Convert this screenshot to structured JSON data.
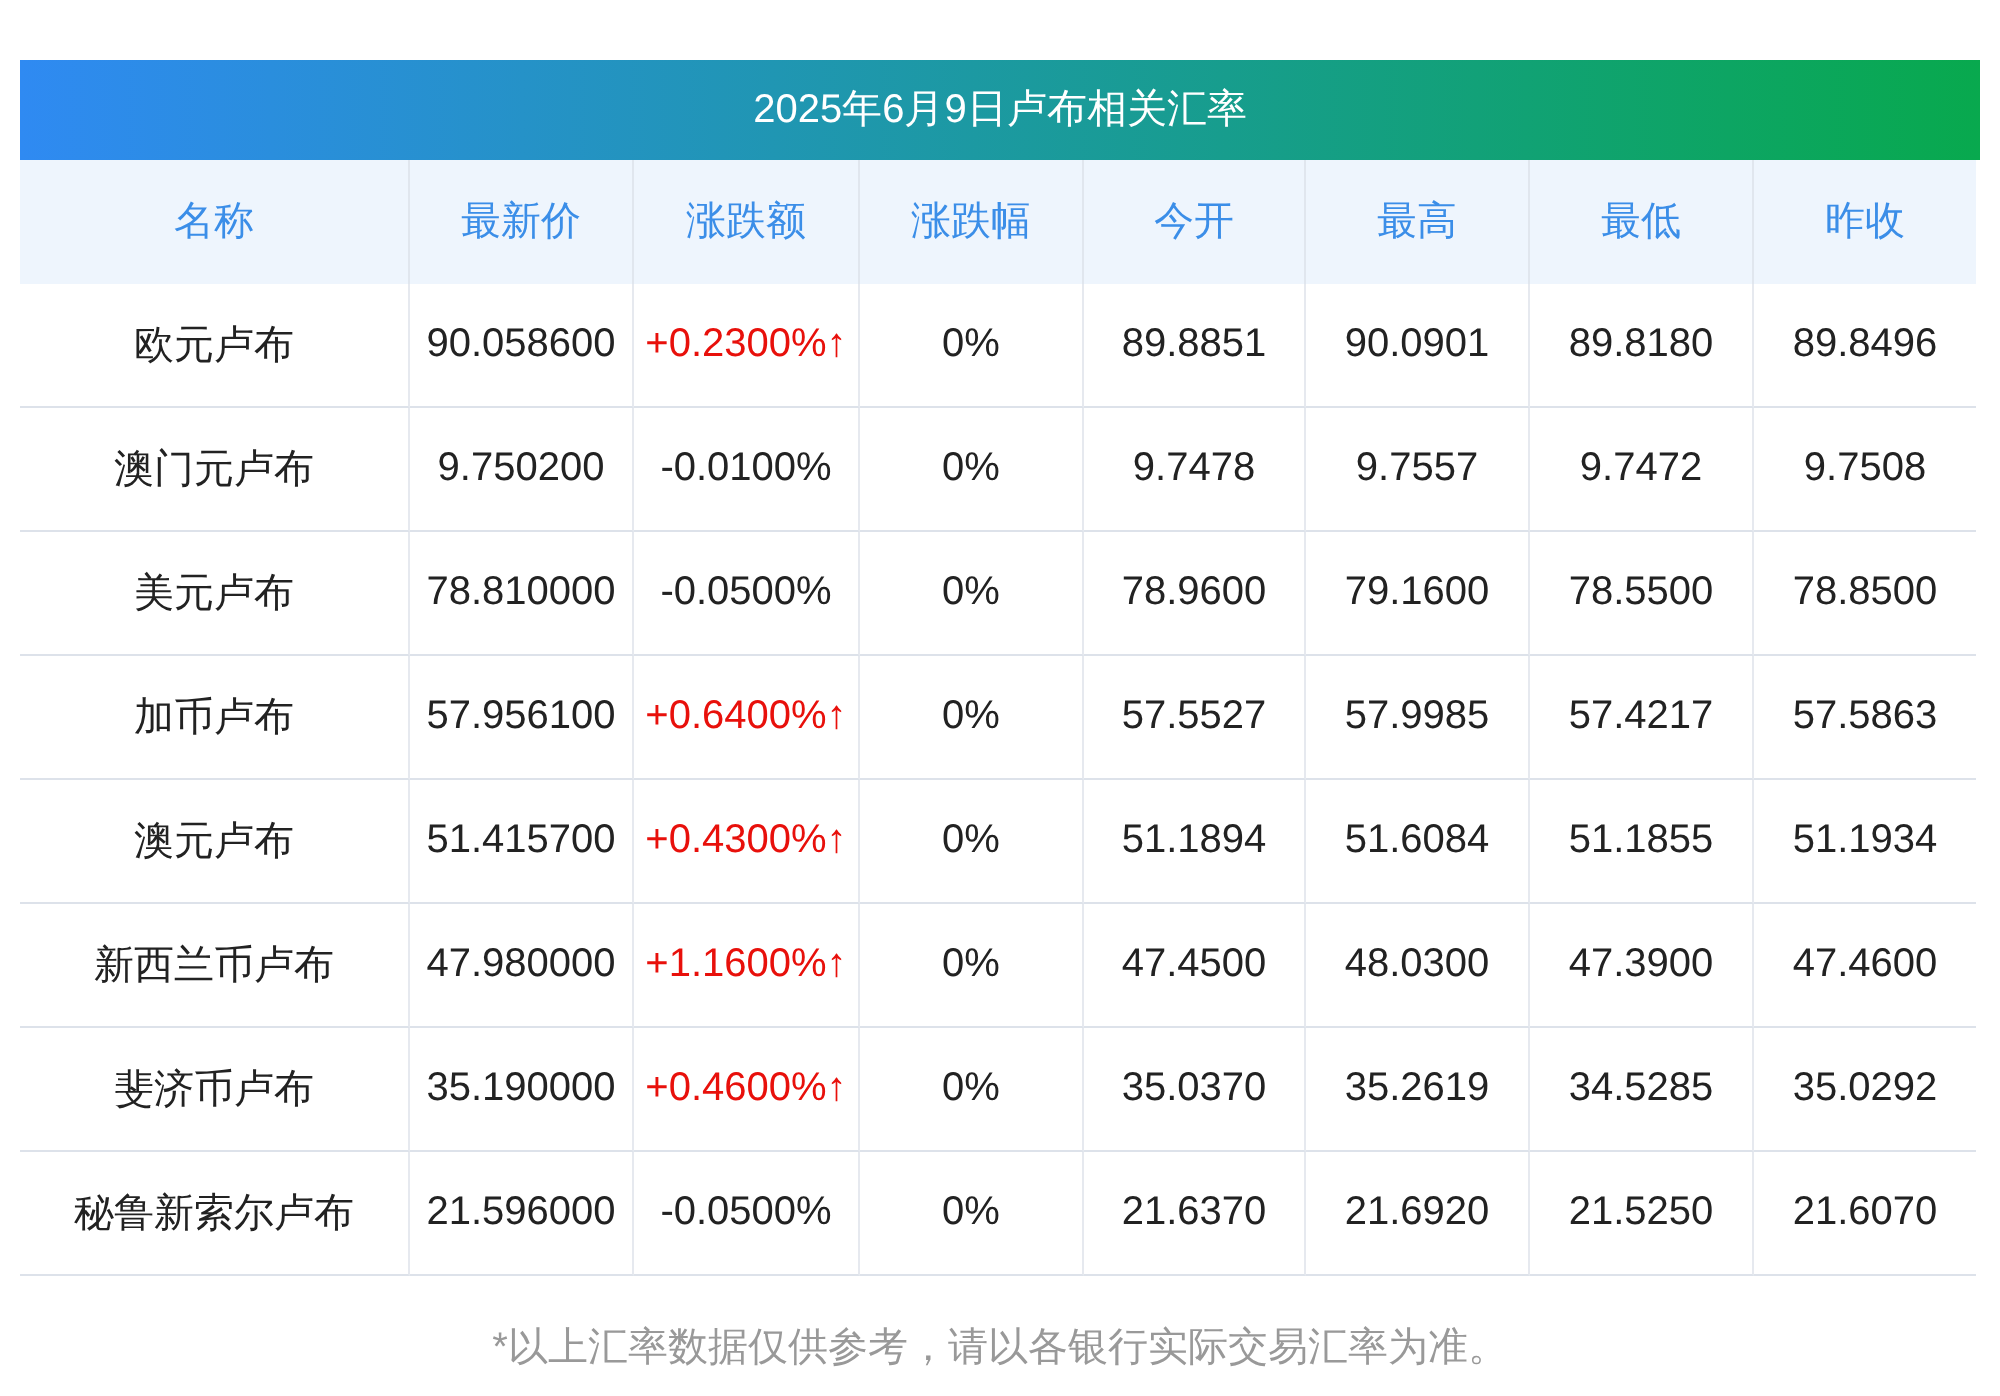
{
  "title": "2025年6月9日卢布相关汇率",
  "columns": [
    "名称",
    "最新价",
    "涨跌额",
    "涨跌幅",
    "今开",
    "最高",
    "最低",
    "昨收"
  ],
  "rows": [
    {
      "name": "欧元卢布",
      "latest": "90.058600",
      "change": "+0.2300%↑",
      "rising": true,
      "pct": "0%",
      "open": "89.8851",
      "high": "90.0901",
      "low": "89.8180",
      "prev": "89.8496"
    },
    {
      "name": "澳门元卢布",
      "latest": "9.750200",
      "change": "-0.0100%",
      "rising": false,
      "pct": "0%",
      "open": "9.7478",
      "high": "9.7557",
      "low": "9.7472",
      "prev": "9.7508"
    },
    {
      "name": "美元卢布",
      "latest": "78.810000",
      "change": "-0.0500%",
      "rising": false,
      "pct": "0%",
      "open": "78.9600",
      "high": "79.1600",
      "low": "78.5500",
      "prev": "78.8500"
    },
    {
      "name": "加币卢布",
      "latest": "57.956100",
      "change": "+0.6400%↑",
      "rising": true,
      "pct": "0%",
      "open": "57.5527",
      "high": "57.9985",
      "low": "57.4217",
      "prev": "57.5863"
    },
    {
      "name": "澳元卢布",
      "latest": "51.415700",
      "change": "+0.4300%↑",
      "rising": true,
      "pct": "0%",
      "open": "51.1894",
      "high": "51.6084",
      "low": "51.1855",
      "prev": "51.1934"
    },
    {
      "name": "新西兰币卢布",
      "latest": "47.980000",
      "change": "+1.1600%↑",
      "rising": true,
      "pct": "0%",
      "open": "47.4500",
      "high": "48.0300",
      "low": "47.3900",
      "prev": "47.4600"
    },
    {
      "name": "斐济币卢布",
      "latest": "35.190000",
      "change": "+0.4600%↑",
      "rising": true,
      "pct": "0%",
      "open": "35.0370",
      "high": "35.2619",
      "low": "34.5285",
      "prev": "35.0292"
    },
    {
      "name": "秘鲁新索尔卢布",
      "latest": "21.596000",
      "change": "-0.0500%",
      "rising": false,
      "pct": "0%",
      "open": "21.6370",
      "high": "21.6920",
      "low": "21.5250",
      "prev": "21.6070"
    }
  ],
  "footnote": "*以上汇率数据仅供参考，请以各银行实际交易汇率为准。"
}
